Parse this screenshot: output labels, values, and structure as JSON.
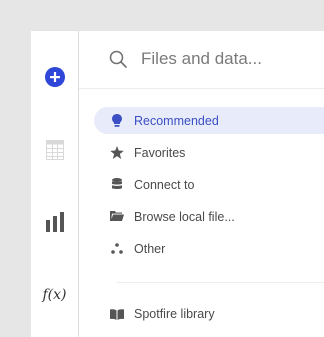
{
  "rail": {
    "items": [
      {
        "name": "add",
        "icon": "plus-circle-icon"
      },
      {
        "name": "table",
        "icon": "table-icon"
      },
      {
        "name": "chart",
        "icon": "bar-chart-icon"
      },
      {
        "name": "function",
        "icon": "function-icon",
        "label": "f(x)"
      }
    ]
  },
  "search": {
    "placeholder": "Files and data...",
    "icon": "search-icon"
  },
  "menu": {
    "items": [
      {
        "label": "Recommended",
        "icon": "lightbulb-icon",
        "active": true
      },
      {
        "label": "Favorites",
        "icon": "star-icon",
        "active": false
      },
      {
        "label": "Connect to",
        "icon": "database-icon",
        "active": false
      },
      {
        "label": "Browse local file...",
        "icon": "folder-icon",
        "active": false
      },
      {
        "label": "Other",
        "icon": "dots-icon",
        "active": false
      }
    ],
    "library": {
      "label": "Spotfire library",
      "icon": "book-icon"
    }
  },
  "colors": {
    "accent": "#3c4fc4",
    "add_button": "#2f47d8",
    "active_bg": "#e8ebfa",
    "icon_gray": "#555555"
  }
}
